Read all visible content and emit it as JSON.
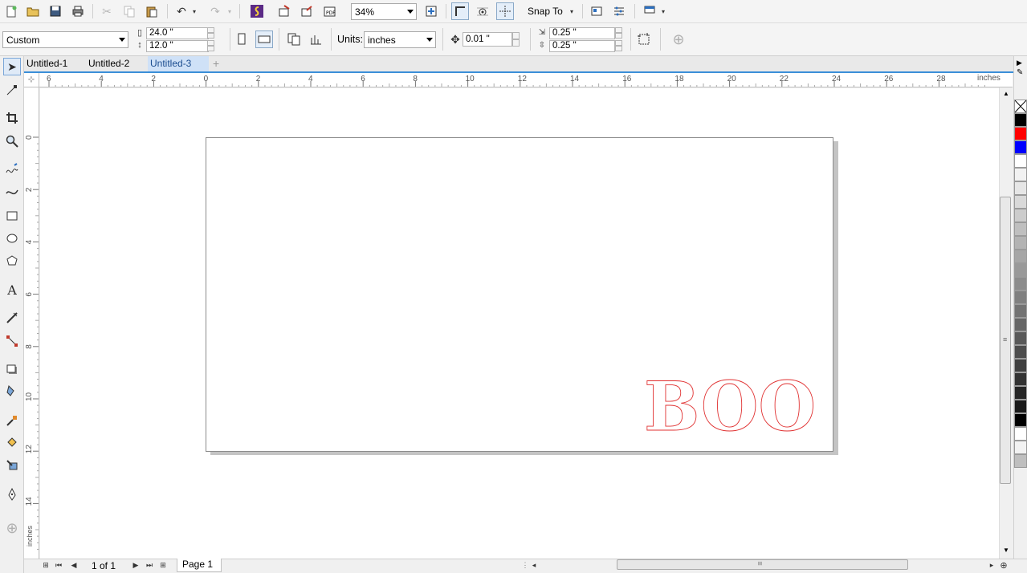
{
  "toolbar": {
    "zoom": "34%",
    "snap_label": "Snap To"
  },
  "property_bar": {
    "preset": "Custom",
    "width": "24.0 \"",
    "height": "12.0 \"",
    "units_label": "Units:",
    "units_value": "inches",
    "nudge": "0.01 \"",
    "dup_x": "0.25 \"",
    "dup_y": "0.25 \""
  },
  "tabs": [
    "Untitled-1",
    "Untitled-2",
    "Untitled-3"
  ],
  "active_tab": 2,
  "ruler": {
    "unit": "inches",
    "h_labels": [
      "6",
      "4",
      "2",
      "0",
      "2",
      "4",
      "6",
      "8",
      "10",
      "12",
      "14",
      "16",
      "18",
      "20",
      "22",
      "24",
      "26",
      "28"
    ],
    "v_labels": [
      "0",
      "2",
      "4",
      "6",
      "8",
      "10",
      "12",
      "14"
    ]
  },
  "document": {
    "text_object": "BOO",
    "outline_color": "#e03030"
  },
  "status": {
    "page_count": "1 of 1",
    "page_tab": "Page 1"
  },
  "palette": [
    "#000000",
    "#ff0000",
    "#0000ff",
    "#ffffff",
    "#f2f2f2",
    "#e6e6e6",
    "#d9d9d9",
    "#cccccc",
    "#bfbfbf",
    "#b3b3b3",
    "#a6a6a6",
    "#999999",
    "#8c8c8c",
    "#808080",
    "#737373",
    "#666666",
    "#595959",
    "#4d4d4d",
    "#404040",
    "#333333",
    "#262626",
    "#1a1a1a",
    "#000000",
    "#ffffff",
    "#f2f2f2",
    "#bfbfbf"
  ]
}
